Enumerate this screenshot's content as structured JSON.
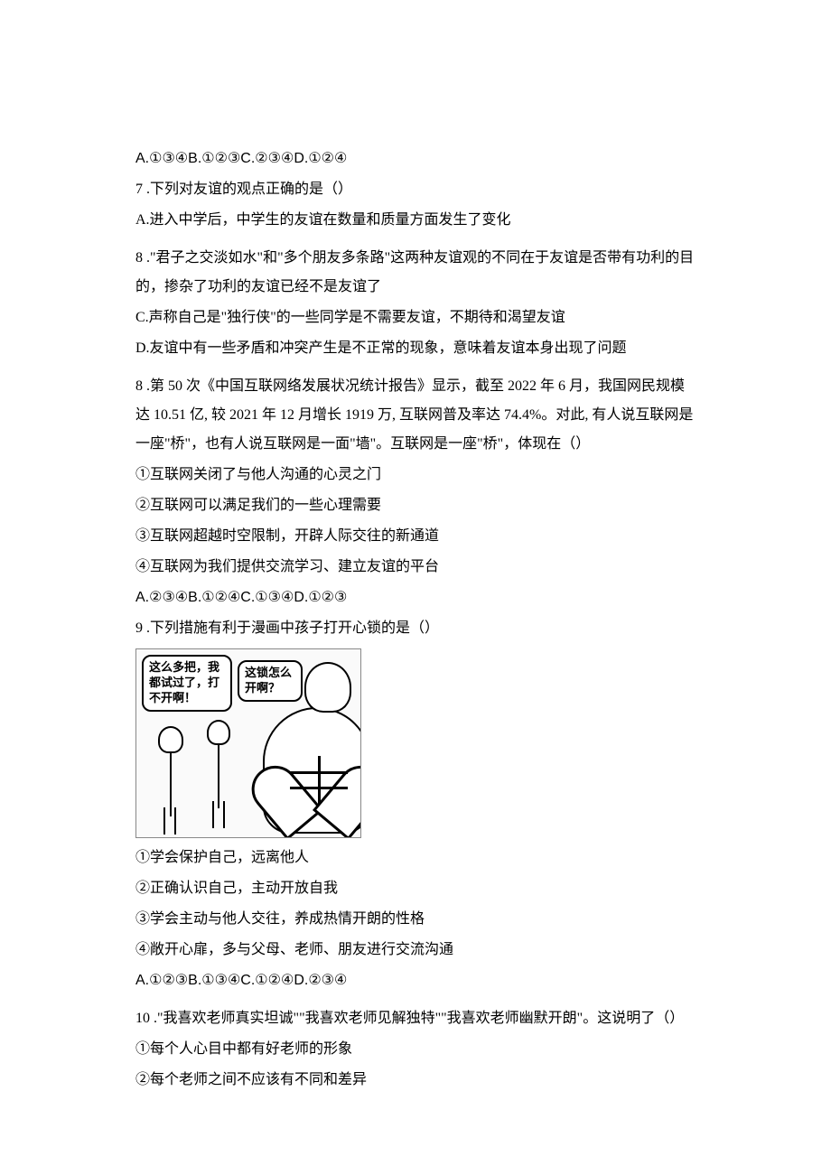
{
  "q6_options": "A.①③④B.①②③C.②③④D.①②④",
  "q7": {
    "stem": "7 .下列对友谊的观点正确的是（）",
    "a": "A.进入中学后，中学生的友谊在数量和质量方面发生了变化",
    "b_pre": "8 .\"君子之交淡如水\"和\"多个朋友多条路\"这两种友谊观的不同在于友谊是否带有功利的目的，掺杂了功利的友谊已经不是友谊了",
    "c": "C.声称自己是\"独行侠\"的一些同学是不需要友谊，不期待和渴望友谊",
    "d": "D.友谊中有一些矛盾和冲突产生是不正常的现象，意味着友谊本身出现了问题"
  },
  "q8": {
    "stem1": "8 .第 50 次《中国互联网络发展状况统计报告》显示，截至 2022 年 6 月，我国网民规模达 10.51 亿, 较 2021 年 12 月增长 1919 万, 互联网普及率达 74.4%。对此, 有人说互联网是一座\"桥\"，也有人说互联网是一面\"墙\"。互联网是一座\"桥\"，体现在（）",
    "s1": "①互联网关闭了与他人沟通的心灵之门",
    "s2": "②互联网可以满足我们的一些心理需要",
    "s3": "③互联网超越时空限制，开辟人际交往的新通道",
    "s4": "④互联网为我们提供交流学习、建立友谊的平台",
    "options": "A.②③④B.①②④C.①③④D.①②③"
  },
  "q9": {
    "stem": "9 .下列措施有利于漫画中孩子打开心锁的是（）",
    "bubble1": "这么多把，我都试过了，打不开啊！",
    "bubble2": "这锁怎么开啊？",
    "s1": "①学会保护自己，远离他人",
    "s2": "②正确认识自己，主动开放自我",
    "s3": "③学会主动与他人交往，养成热情开朗的性格",
    "s4": "④敞开心扉，多与父母、老师、朋友进行交流沟通",
    "options": "A.①②③B.①③④C.①②④D.②③④"
  },
  "q10": {
    "stem": "10 .\"我喜欢老师真实坦诚\"\"我喜欢老师见解独特\"\"我喜欢老师幽默开朗\"。这说明了（）",
    "s1": "①每个人心目中都有好老师的形象",
    "s2": "②每个老师之间不应该有不同和差异"
  }
}
